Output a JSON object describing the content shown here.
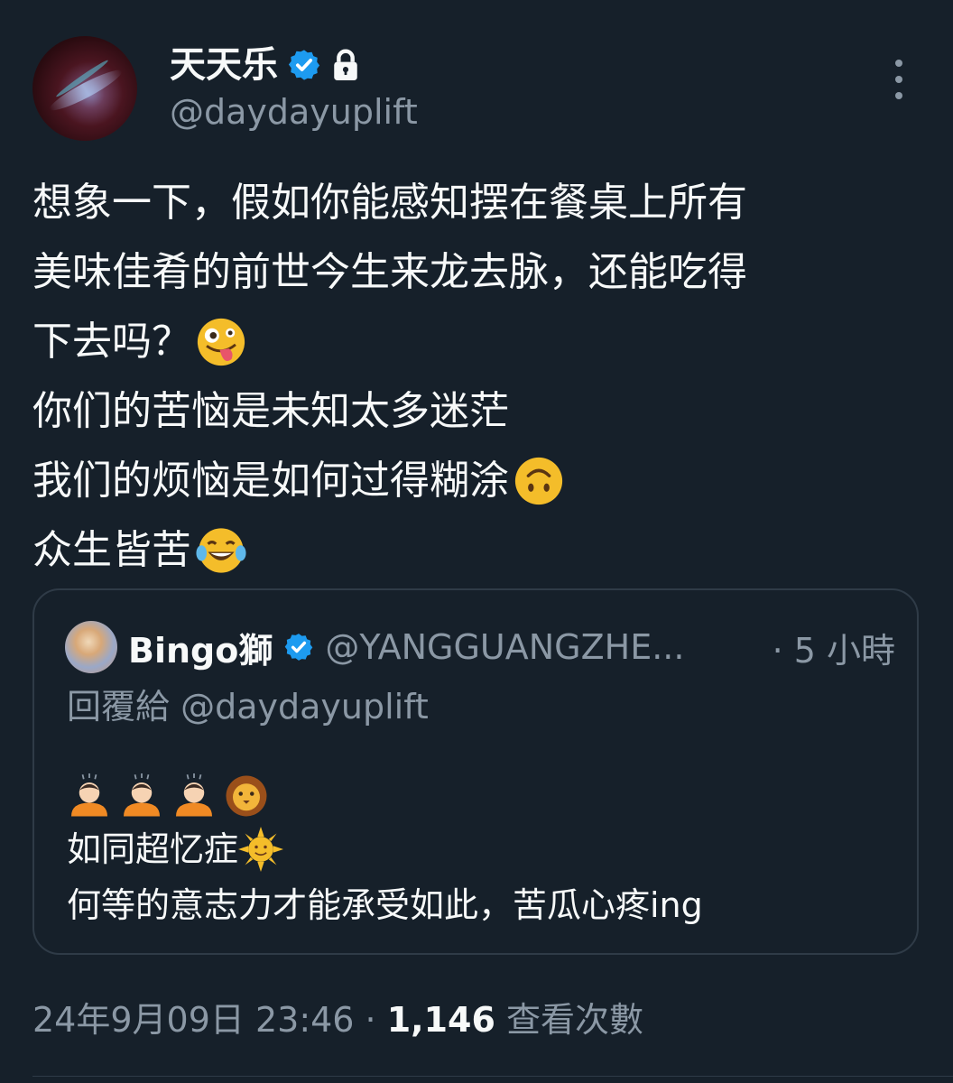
{
  "author": {
    "display_name": "天天乐",
    "handle": "@daydayuplift"
  },
  "tweet": {
    "lines": [
      "想象一下，假如你能感知摆在餐桌上所有",
      "美味佳肴的前世今生来龙去脉，还能吃得",
      "下去吗？",
      "你们的苦恼是未知太多迷茫",
      "我们的烦恼是如何过得糊涂",
      "众生皆苦"
    ],
    "emojis": [
      "zany-face",
      "upside-down-face",
      "face-with-tears-of-joy"
    ]
  },
  "quoted": {
    "name": "Bingo獅",
    "handle": "@YANGGUANGZHE...",
    "time": "· 5 小時",
    "reply_to": "回覆給 @daydayuplift",
    "emoji_row": [
      "person-bowing",
      "person-bowing",
      "person-bowing",
      "lion-face"
    ],
    "lines": [
      "如同超忆症",
      "何等的意志力才能承受如此，苦瓜心疼ing"
    ]
  },
  "footer": {
    "timestamp": "24年9月09日 23:46 · ",
    "views": "1,146",
    "views_label": " 查看次數"
  },
  "colors": {
    "background": "#16202a",
    "verified": "#1d9bf0",
    "muted": "#8b98a5",
    "border": "#2f3b47"
  }
}
